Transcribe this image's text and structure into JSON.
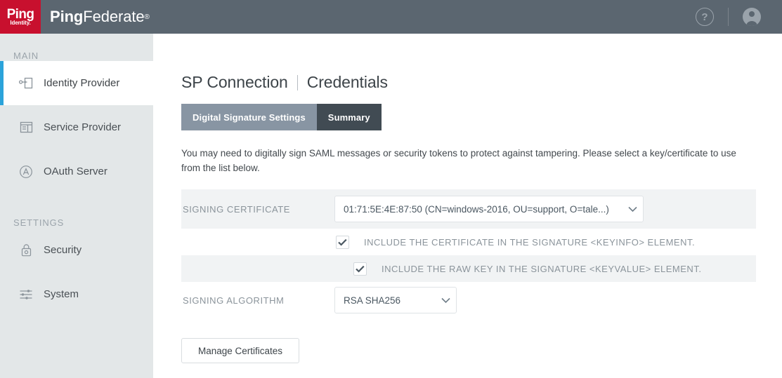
{
  "colors": {
    "header_bg": "#5b6670",
    "logo_red": "#c8102e",
    "sidebar_bg": "#e3e7e8",
    "accent_blue": "#2ba3da",
    "tab_active": "#8895a3",
    "tab_inactive": "#414b53",
    "row_stripe": "#f1f3f4",
    "label_gray": "#8b949b"
  },
  "header": {
    "logo": {
      "ping": "Ping",
      "identity": "Identity.",
      "icon_name": "ping-identity-logo"
    },
    "brand_bold": "Ping",
    "brand_light": "Federate",
    "brand_registered": "®",
    "help_label": "?",
    "help_icon": "help-circle-icon",
    "avatar_icon": "user-avatar-icon"
  },
  "sidebar": {
    "groups": [
      {
        "label": "MAIN",
        "items": [
          {
            "label": "Identity Provider",
            "icon": "identity-provider-icon",
            "active": true
          },
          {
            "label": "Service Provider",
            "icon": "service-provider-icon",
            "active": false
          },
          {
            "label": "OAuth Server",
            "icon": "oauth-server-icon",
            "active": false
          }
        ]
      },
      {
        "label": "SETTINGS",
        "items": [
          {
            "label": "Security",
            "icon": "lock-icon",
            "active": false
          },
          {
            "label": "System",
            "icon": "sliders-icon",
            "active": false
          }
        ]
      }
    ]
  },
  "main": {
    "title_primary": "SP Connection",
    "title_secondary": "Credentials",
    "tabs": [
      {
        "label": "Digital Signature Settings",
        "active": true
      },
      {
        "label": "Summary",
        "active": false
      }
    ],
    "intro": "You may need to digitally sign SAML messages or security tokens to protect against tampering. Please select a key/certificate to use from the list below.",
    "fields": {
      "signing_certificate": {
        "label": "SIGNING CERTIFICATE",
        "value": "01:71:5E:4E:87:50 (CN=windows-2016, OU=support, O=tale...)",
        "chevron_icon": "chevron-down-icon"
      },
      "include_certificate": {
        "label": "INCLUDE THE CERTIFICATE IN THE SIGNATURE <KEYINFO> ELEMENT.",
        "checked": true,
        "check_icon": "checkmark-icon"
      },
      "include_raw_key": {
        "label": "INCLUDE THE RAW KEY IN THE SIGNATURE <KEYVALUE> ELEMENT.",
        "checked": true,
        "check_icon": "checkmark-icon"
      },
      "signing_algorithm": {
        "label": "SIGNING ALGORITHM",
        "value": "RSA SHA256",
        "chevron_icon": "chevron-down-icon"
      }
    },
    "manage_certificates_label": "Manage Certificates"
  }
}
